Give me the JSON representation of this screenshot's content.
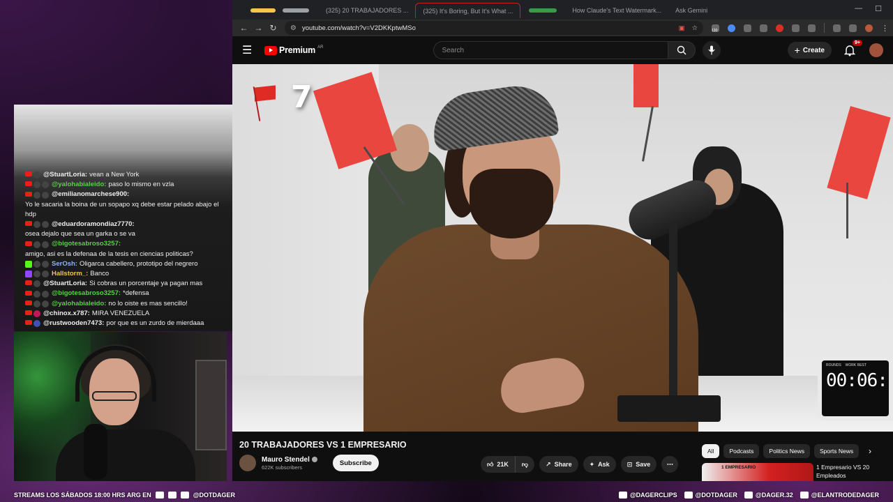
{
  "browser": {
    "tabs": [
      "(325) 20 TRABAJADORES ...",
      "(325) It's Boring, But It's What ...",
      "How Claude's Text Watermark...",
      "Ask Gemini"
    ],
    "url": "youtube.com/watch?v=V2DKKptwMSo",
    "ext_count": "130"
  },
  "youtube": {
    "logo": "Premium",
    "region": "AR",
    "search_placeholder": "Search",
    "create_label": "Create",
    "notif_count": "9+"
  },
  "video": {
    "flag_count": "7",
    "timer_labels": [
      "ROUNDS",
      "WORK REST"
    ],
    "timer_digits": "00:06:",
    "title": "20 TRABAJADORES VS 1 EMPRESARIO",
    "channel_name": "Mauro Stendel",
    "subscribers": "622K subscribers",
    "subscribe_label": "Subscribe",
    "likes": "21K",
    "share_label": "Share",
    "ask_label": "Ask",
    "save_label": "Save"
  },
  "chips": [
    "All",
    "Podcasts",
    "Politics News",
    "Sports News"
  ],
  "related": {
    "tag": "1 EMPRESARIO",
    "title": "1 Empresario VS 20 Empleados"
  },
  "chat": [
    {
      "user": "@StuartLoria:",
      "text": "vean a New York",
      "color": "#ffffff"
    },
    {
      "user": "@yalohabialeido:",
      "text": "paso lo mismo en vzla",
      "color": "#5bcf4a"
    },
    {
      "user": "@emilianomarchese900:",
      "text": "Yo le sacaria la boina de un sopapo xq debe estar pelado abajo el hdp",
      "color": "#ffffff"
    },
    {
      "user": "@eduardoramondiaz7770:",
      "text": "osea dejalo que sea un garka o se va",
      "color": "#ffffff"
    },
    {
      "user": "@bigotesabroso3257:",
      "text": "amigo, asi es la defenaa de la tesis en ciencias politicas?",
      "color": "#5bcf4a"
    },
    {
      "user": "SerOsh:",
      "text": "Oligarca cabellero, prototipo del negrero",
      "color": "#8ab4f8"
    },
    {
      "user": "Hallstorm_:",
      "text": "Banco",
      "color": "#f3c54a"
    },
    {
      "user": "@StuartLoria:",
      "text": "Si cobras un porcentaje ya pagan mas",
      "color": "#ffffff"
    },
    {
      "user": "@bigotesabroso3257:",
      "text": "*defensa",
      "color": "#5bcf4a"
    },
    {
      "user": "@yalohabialeido:",
      "text": "no lo oiste es mas sencillo!",
      "color": "#5bcf4a"
    },
    {
      "user": "@chinox.x787:",
      "text": "MIRA VENEZUELA",
      "color": "#ffffff"
    },
    {
      "user": "@rustwooden7473:",
      "text": "por que es un zurdo de mierdaaa",
      "color": "#ffffff"
    }
  ],
  "bottom_bar": {
    "left_text": "STREAMS LOS SÁBADOS 18:00 HRS ARG EN",
    "left_handle": "@DOTDAGER",
    "right_handles": [
      "@DAGERCLIPS",
      "@DOTDAGER",
      "@DAGER.32",
      "@ELANTRODEDAGER"
    ]
  }
}
